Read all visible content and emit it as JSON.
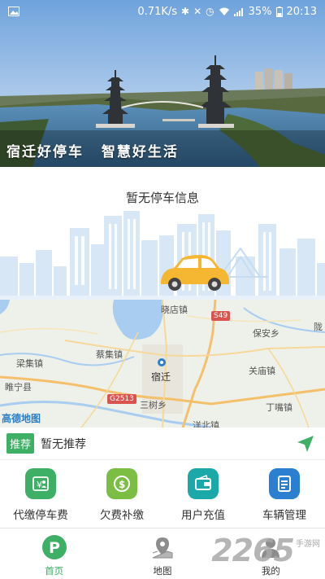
{
  "status_bar": {
    "speed": "0.71K/s",
    "battery": "35%",
    "time": "20:13"
  },
  "hero": {
    "slogan_part1": "宿迁好停车",
    "slogan_part2": "智慧好生活"
  },
  "parking": {
    "empty_text": "暂无停车信息"
  },
  "map": {
    "labels": {
      "xiaodian": "晓店镇",
      "baoan": "保安乡",
      "long": "陇",
      "liangji": "梁集镇",
      "caiji": "蔡集镇",
      "guanmiao": "关庙镇",
      "suining": "睢宁县",
      "suqian": "宿迁",
      "sanshu": "三树乡",
      "dingzui": "丁嘴镇",
      "yangbei": "洋北镇"
    },
    "shields": {
      "s49": "S49",
      "g2513": "G2513"
    },
    "logo": "高德地图"
  },
  "recommend": {
    "tag": "推荐",
    "text": "暂无推荐"
  },
  "actions": [
    {
      "label": "代缴停车费",
      "color": "#3db065"
    },
    {
      "label": "欠费补缴",
      "color": "#7cbd43"
    },
    {
      "label": "用户充值",
      "color": "#1aa8a8"
    },
    {
      "label": "车辆管理",
      "color": "#2a7fd0"
    }
  ],
  "tabs": [
    {
      "label": "首页"
    },
    {
      "label": "地图"
    },
    {
      "label": "我的"
    }
  ],
  "watermark": {
    "number": "2265",
    "site": "手游网"
  },
  "colors": {
    "accent": "#3db065"
  }
}
